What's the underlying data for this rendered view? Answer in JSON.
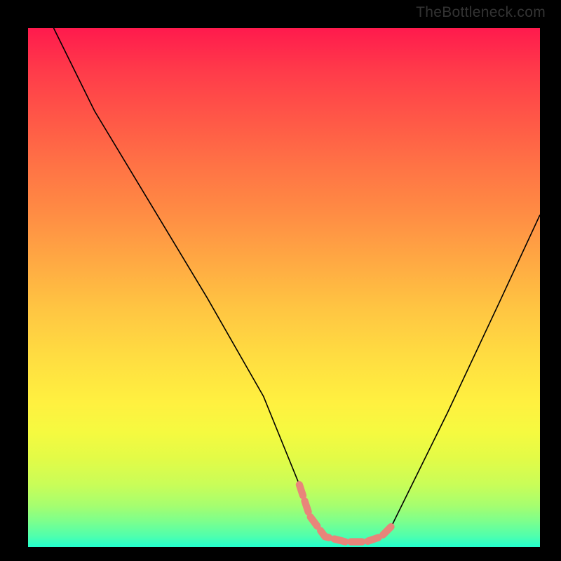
{
  "watermark": "TheBottleneck.com",
  "chart_data": {
    "type": "line",
    "title": "",
    "xlabel": "",
    "ylabel": "",
    "xlim": [
      0,
      100
    ],
    "ylim": [
      0,
      100
    ],
    "series": [
      {
        "name": "black-curve",
        "color": "#000000",
        "x": [
          5,
          13,
          24,
          35,
          46,
          53,
          55,
          58,
          62,
          66,
          69,
          71,
          74,
          82,
          92,
          100
        ],
        "y": [
          100,
          84,
          66,
          48,
          29,
          12,
          6,
          2,
          1,
          1,
          2,
          4,
          10,
          26,
          47,
          64
        ]
      },
      {
        "name": "pink-band",
        "color": "#e8857a",
        "x": [
          53,
          55,
          58,
          62,
          66,
          69,
          71
        ],
        "y": [
          12,
          6,
          2,
          1,
          1,
          2,
          4
        ]
      }
    ]
  }
}
